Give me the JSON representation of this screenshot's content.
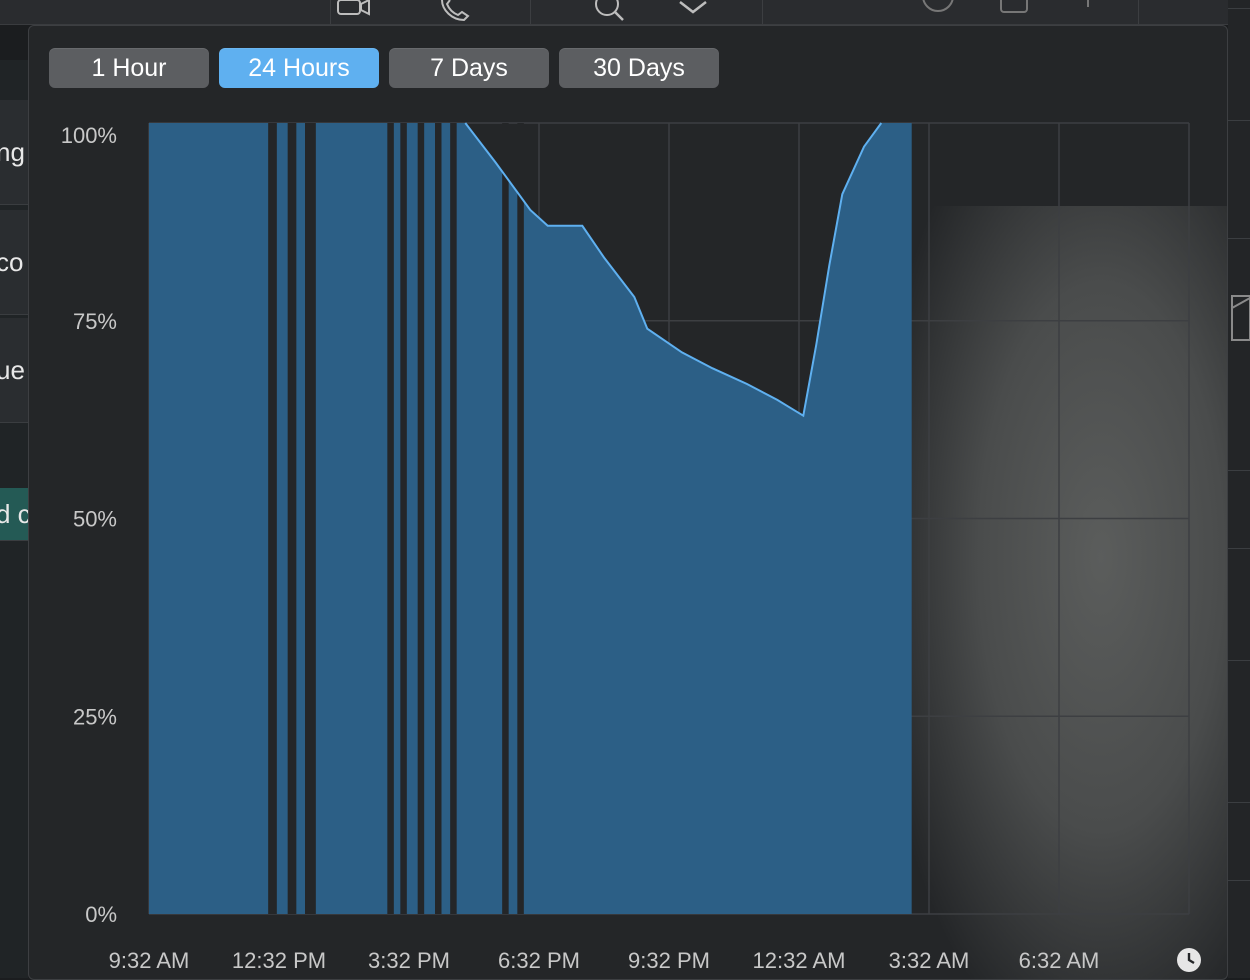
{
  "background": {
    "left_fragments": [
      "ng",
      "co",
      "ue",
      "d c"
    ]
  },
  "range_tabs": [
    {
      "label": "1 Hour",
      "active": false
    },
    {
      "label": "24 Hours",
      "active": true
    },
    {
      "label": "7 Days",
      "active": false
    },
    {
      "label": "30 Days",
      "active": false
    }
  ],
  "colors": {
    "accent": "#5fb0f0",
    "fill": "#2c5f86",
    "line": "#5fb0f0",
    "grid": "#3d3f42"
  },
  "chart_data": {
    "type": "area",
    "y_ticks": [
      "0%",
      "25%",
      "50%",
      "75%",
      "100%"
    ],
    "x_ticks": [
      "9:32 AM",
      "12:32 PM",
      "3:32 PM",
      "6:32 PM",
      "9:32 PM",
      "12:32 AM",
      "3:32 AM",
      "6:32 AM"
    ],
    "x_unit": "hours since 9:32 AM",
    "xlim": [
      0,
      24
    ],
    "ylim": [
      0,
      100
    ],
    "grid": true,
    "series": [
      {
        "points": [
          [
            0.0,
            100
          ],
          [
            7.3,
            100
          ],
          [
            8.0,
            95
          ],
          [
            8.8,
            89
          ],
          [
            9.2,
            87
          ],
          [
            10.0,
            87
          ],
          [
            10.5,
            83
          ],
          [
            11.2,
            78
          ],
          [
            11.5,
            74
          ],
          [
            12.3,
            71
          ],
          [
            13.0,
            69
          ],
          [
            13.8,
            67
          ],
          [
            14.5,
            65
          ],
          [
            14.8,
            64
          ],
          [
            15.1,
            63
          ],
          [
            15.4,
            72
          ],
          [
            15.7,
            82
          ],
          [
            16.0,
            91
          ],
          [
            16.5,
            97
          ],
          [
            16.9,
            100
          ],
          [
            17.6,
            100
          ]
        ],
        "gaps": [
          [
            2.75,
            2.95
          ],
          [
            3.2,
            3.4
          ],
          [
            3.6,
            3.85
          ],
          [
            5.5,
            5.65
          ],
          [
            5.8,
            5.95
          ],
          [
            6.2,
            6.35
          ],
          [
            6.6,
            6.75
          ],
          [
            6.95,
            7.1
          ],
          [
            8.15,
            8.3
          ],
          [
            8.5,
            8.65
          ]
        ]
      }
    ]
  },
  "icons": [
    "video-icon",
    "phone-icon",
    "search-icon",
    "chevron-down-icon",
    "download-icon",
    "square-icon",
    "more-icon",
    "clock-icon"
  ]
}
